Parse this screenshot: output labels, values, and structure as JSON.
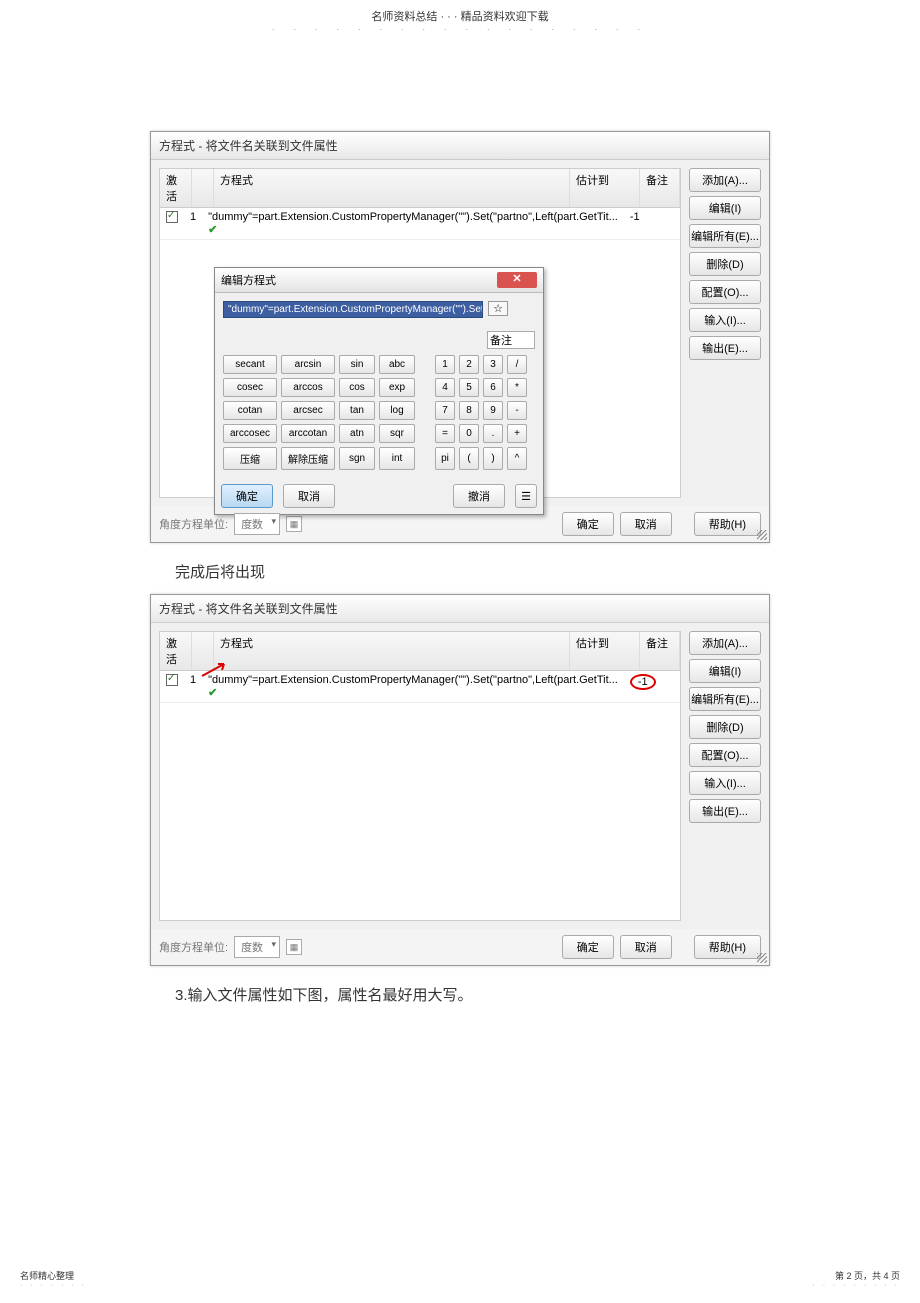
{
  "header": {
    "title_left": "名师资料总结",
    "title_sep": "· · ·",
    "title_right": "精品资料欢迎下载",
    "dots": "· · · · · · · · · · · · · · · · · ·"
  },
  "dialog1": {
    "title": "方程式 - 将文件名关联到文件属性",
    "columns": {
      "activate": "激活",
      "equation": "方程式",
      "value": "估计到",
      "note": "备注"
    },
    "row": {
      "index": "1",
      "equation": "\"dummy\"=part.Extension.CustomPropertyManager(\"\").Set(\"partno\",Left(part.GetTit...",
      "check": "✔",
      "value": "-1"
    },
    "side": {
      "add": "添加(A)...",
      "edit": "编辑(I)",
      "editall": "编辑所有(E)...",
      "delete": "删除(D)",
      "config": "配置(O)...",
      "import": "输入(I)...",
      "export": "输出(E)..."
    },
    "unit_label": "角度方程单位:",
    "unit_value": "度数",
    "ok": "确定",
    "cancel": "取消",
    "help": "帮助(H)"
  },
  "editor": {
    "title": "编辑方程式",
    "close": "✕",
    "eq": "\"dummy\"=part.Extension.CustomPropertyManager(\"\").Set(\"partno\",Left(part",
    "collapse": "☆",
    "note_label": "备注",
    "calc": {
      "r1": [
        "secant",
        "arcsin",
        "sin",
        "abc",
        "",
        "1",
        "2",
        "3",
        "/"
      ],
      "r2": [
        "cosec",
        "arccos",
        "cos",
        "exp",
        "",
        "4",
        "5",
        "6",
        "*"
      ],
      "r3": [
        "cotan",
        "arcsec",
        "tan",
        "log",
        "",
        "7",
        "8",
        "9",
        "-"
      ],
      "r4": [
        "arccosec",
        "arccotan",
        "atn",
        "sqr",
        "",
        "=",
        "0",
        ".",
        "+"
      ],
      "r5": [
        "压缩",
        "解除压缩",
        "sgn",
        "int",
        "",
        "pi",
        "(",
        ")",
        "^"
      ]
    },
    "ok": "确定",
    "cancel": "取消",
    "undo": "撤消",
    "expand": "☰"
  },
  "text1": "完成后将出现",
  "dialog2": {
    "title": "方程式 - 将文件名关联到文件属性",
    "columns": {
      "activate": "激活",
      "equation": "方程式",
      "value": "估计到",
      "note": "备注"
    },
    "row": {
      "index": "1",
      "equation": "\"dummy\"=part.Extension.CustomPropertyManager(\"\").Set(\"partno\",Left(part.GetTit...",
      "value": "-1"
    },
    "side": {
      "add": "添加(A)...",
      "edit": "编辑(I)",
      "editall": "编辑所有(E)...",
      "delete": "删除(D)",
      "config": "配置(O)...",
      "import": "输入(I)...",
      "export": "输出(E)..."
    },
    "unit_label": "角度方程单位:",
    "unit_value": "度数",
    "ok": "确定",
    "cancel": "取消",
    "help": "帮助(H)"
  },
  "text2": "3.输入文件属性如下图，属性名最好用大写。",
  "footer": {
    "left": "名师精心整理",
    "right": "第 2 页，共 4 页"
  }
}
